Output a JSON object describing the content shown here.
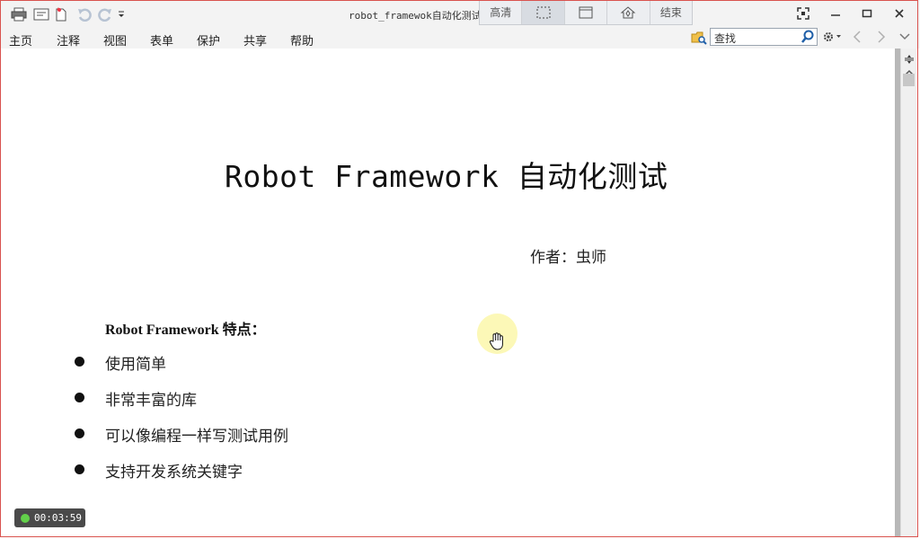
{
  "window": {
    "title_prefix": "robot_framewok",
    "title_suffix": "自动化测试"
  },
  "recorder_toolbar": {
    "items": [
      "高清",
      "",
      "",
      "",
      "结束"
    ]
  },
  "menu": {
    "items": [
      "主页",
      "注释",
      "视图",
      "表单",
      "保护",
      "共享",
      "帮助"
    ]
  },
  "search": {
    "placeholder": "查找"
  },
  "document": {
    "title_latin": "Robot Framework",
    "title_cjk": "自动化测试",
    "author": "作者：虫师",
    "features_heading": "Robot Framework 特点：",
    "bullets": [
      "使用简单",
      "非常丰富的库",
      "可以像编程一样写测试用例",
      "支持开发系统关键字"
    ]
  },
  "recording_timer": "00:03:59",
  "colors": {
    "frame": "#d9534f",
    "timer_dot": "#62d14a"
  }
}
